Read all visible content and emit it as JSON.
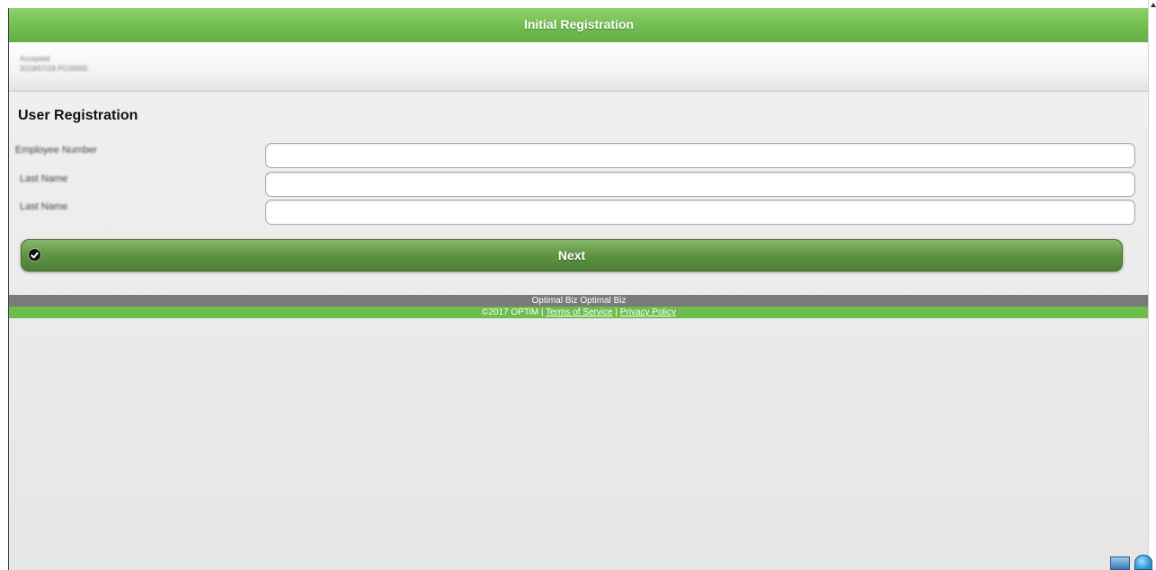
{
  "header": {
    "title": "Initial Registration"
  },
  "info_bar": {
    "line1": "Accepted",
    "line2": "2019/07/29 PC00000"
  },
  "form": {
    "title": "User Registration",
    "fields": [
      {
        "label": "Employee Number",
        "value": ""
      },
      {
        "label": "Last Name",
        "value": ""
      },
      {
        "label": "Last Name",
        "value": ""
      }
    ],
    "next_label": "Next"
  },
  "footer": {
    "product": "Optimal Biz Optimal Biz",
    "copyright": "©2017 OPTiM | ",
    "terms_label": "Terms of Service",
    "separator": " | ",
    "privacy_label": "Privacy Policy"
  },
  "icons": {
    "next_icon": "check-circle-icon",
    "tray": [
      "window-icon",
      "globe-icon"
    ]
  },
  "colors": {
    "header_green": "#6fbb4e",
    "button_green": "#5e9343",
    "footer_gray": "#7a7a7a",
    "footer_green": "#6cbd4c"
  }
}
